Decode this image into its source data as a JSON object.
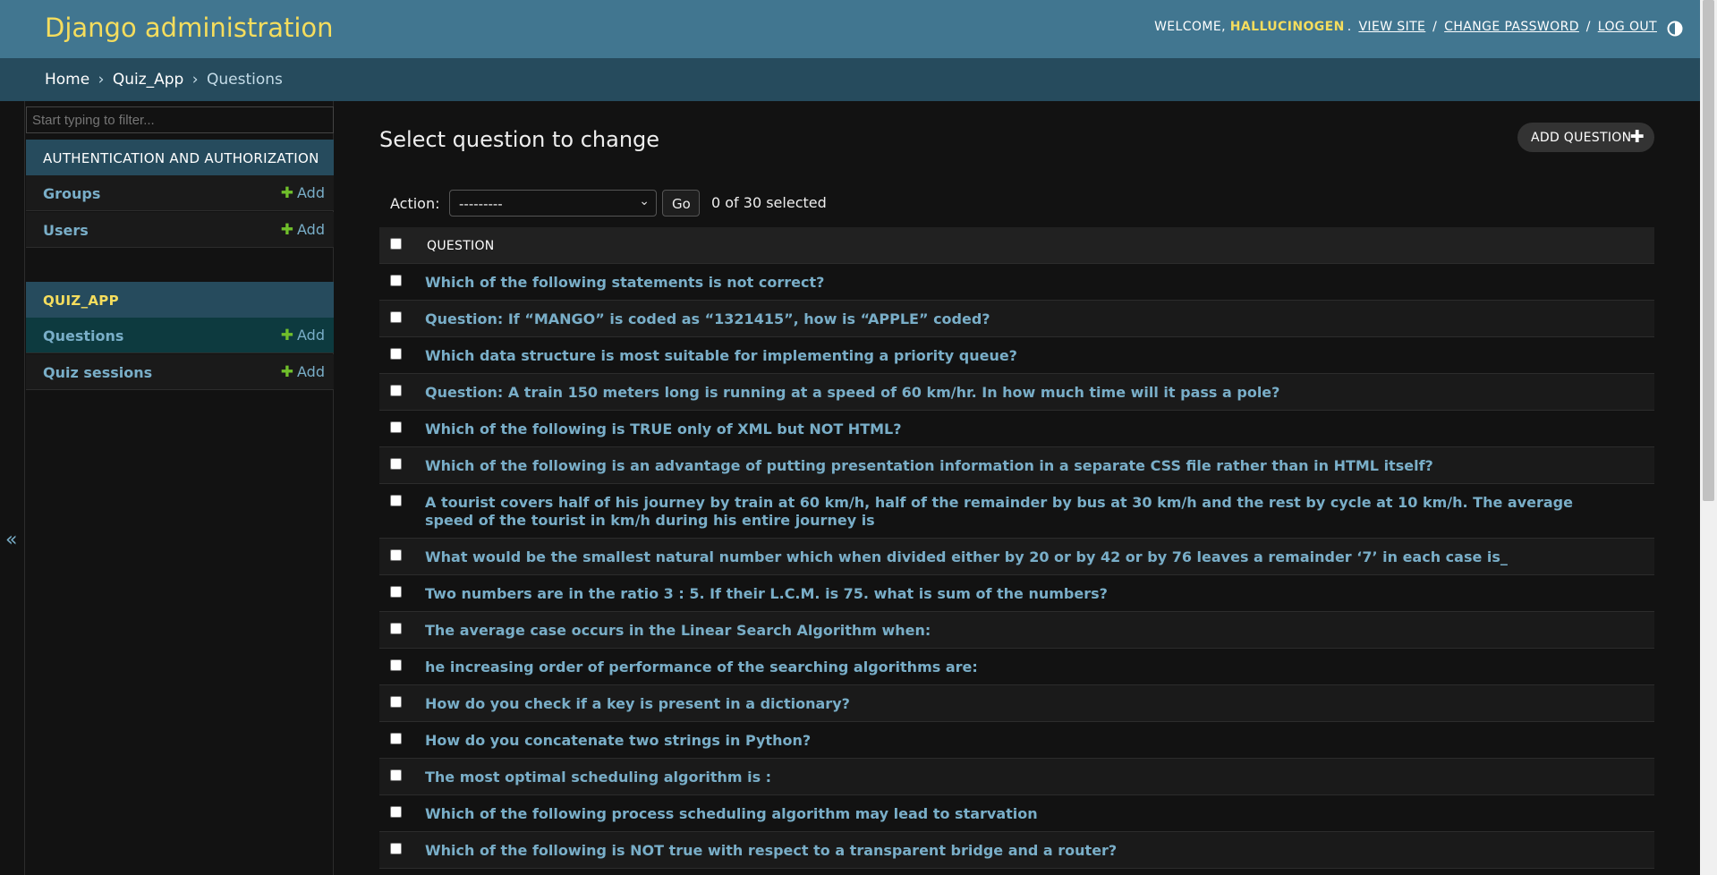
{
  "header": {
    "brand": "Django administration",
    "welcome": "WELCOME,",
    "username": "HALLUCINOGEN",
    "view_site": "VIEW SITE",
    "change_password": "CHANGE PASSWORD",
    "log_out": "LOG OUT",
    "theme_icon": "contrast-icon"
  },
  "breadcrumbs": {
    "home": "Home",
    "app": "Quiz_App",
    "current": "Questions",
    "separator": "›"
  },
  "sidebar": {
    "filter_placeholder": "Start typing to filter...",
    "collapse_icon": "«",
    "add_label": "Add",
    "apps": [
      {
        "caption": "AUTHENTICATION AND AUTHORIZATION",
        "models": [
          "Groups",
          "Users"
        ]
      },
      {
        "caption": "QUIZ_APP",
        "models": [
          "Questions",
          "Quiz sessions"
        ]
      }
    ]
  },
  "content": {
    "title": "Select question to change",
    "add_button": "ADD QUESTION",
    "action_label": "Action:",
    "action_selected": "---------",
    "go_label": "Go",
    "selection_count": "0 of 30 selected",
    "column_header": "QUESTION",
    "questions": [
      "Which of the following statements is not correct?",
      "Question: If “MANGO” is coded as “1321415”, how is “APPLE” coded?",
      "Which data structure is most suitable for implementing a priority queue?",
      "Question: A train 150 meters long is running at a speed of 60 km/hr. In how much time will it pass a pole?",
      "Which of the following is TRUE only of XML but NOT HTML?",
      "Which of the following is an advantage of putting presentation information in a separate CSS file rather than in HTML itself?",
      "A tourist covers half of his journey by train at 60 km/h, half of the remainder by bus at 30 km/h and the rest by cycle at 10 km/h. The average speed of the tourist in km/h during his entire journey is",
      "What would be the smallest natural number which when divided either by 20 or by 42 or by 76 leaves a remainder ‘7’ in each case is_",
      "Two numbers are in the ratio 3 : 5. If their L.C.M. is 75. what is sum of the numbers?",
      "The average case occurs in the Linear Search Algorithm when:",
      "he increasing order of performance of the searching algorithms are:",
      "How do you check if a key is present in a dictionary?",
      "How do you concatenate two strings in Python?",
      "The most optimal scheduling algorithm is :",
      "Which of the following process scheduling algorithm may lead to starvation",
      "Which of the following is NOT true with respect to a transparent bridge and a router?"
    ]
  }
}
